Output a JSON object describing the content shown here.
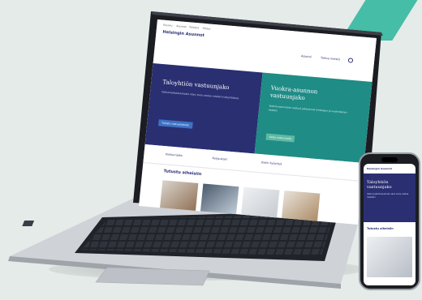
{
  "laptop_site": {
    "logo": "Helsingin Asunnot",
    "nav_items": [
      "Etusivu",
      "Asunnot",
      "Palvelut",
      "Yhteys"
    ],
    "header_links": [
      "Asiointi",
      "Tietoa meistä"
    ],
    "hero_left": {
      "title": "Taloyhtiön vastuunjako",
      "body": "Vastuunjakotaulukosta näet, kuka vastaa mistäkin taloyhtiössä.",
      "button": "Tutustu vastuunjakoon"
    },
    "hero_right": {
      "title": "Vuokra-asunnon vastuunjako",
      "body": "Vuokra-asunnossa vastuut jakautuvat omistajan ja vuokralaisen kesken.",
      "button": "Katso vastuunjako"
    },
    "quick_links": [
      "Vastuunjako",
      "Korjaukset",
      "Usein kysyttyä"
    ],
    "section_title": "Tutustu aiheisiin"
  },
  "phone_site": {
    "logo": "Helsingin Asunnot",
    "hero_title": "Taloyhtiön vastuunjako",
    "hero_body": "Vastuunjakotaulukosta näet, kuka vastaa mistäkin.",
    "section_title": "Tutustu aiheisiin"
  },
  "colors": {
    "background": "#e4ebe8",
    "accent_stripe": "#46bda7",
    "navy": "#2a2f72",
    "teal": "#1f8c86",
    "laptop_shell": "#c9ccd1"
  }
}
